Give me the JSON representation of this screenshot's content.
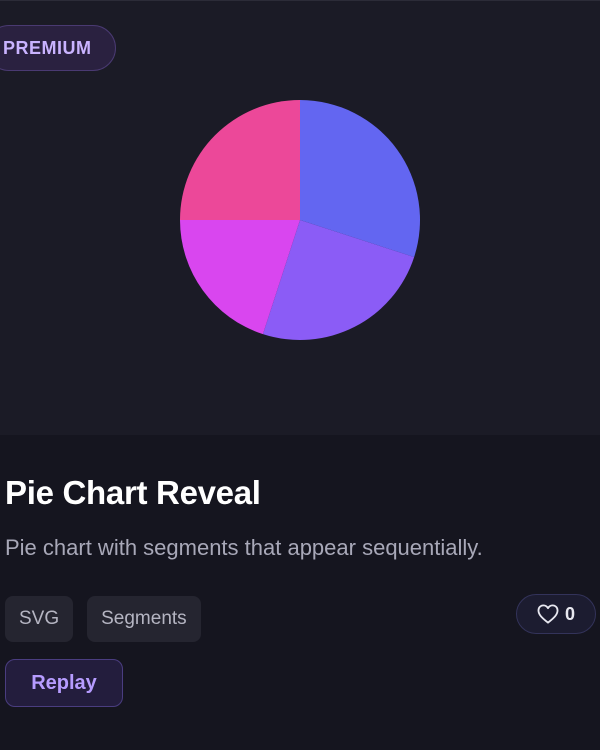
{
  "badge": {
    "label": "PREMIUM"
  },
  "card": {
    "title": "Pie Chart Reveal",
    "description": "Pie chart with segments that appear sequentially.",
    "tags": [
      "SVG",
      "Segments"
    ],
    "likes": "0",
    "replay_label": "Replay"
  },
  "colors": {
    "background": "#15151f",
    "preview_bg": "#1b1b26",
    "accent": "#b69cff"
  },
  "icons": {
    "like": "heart-icon"
  },
  "chart_data": {
    "type": "pie",
    "values": [
      30,
      25,
      20,
      25
    ],
    "colors": [
      "#6366f1",
      "#8b5cf6",
      "#d946ef",
      "#ec4899"
    ],
    "start_angle_deg": 0,
    "direction": "clockwise"
  }
}
